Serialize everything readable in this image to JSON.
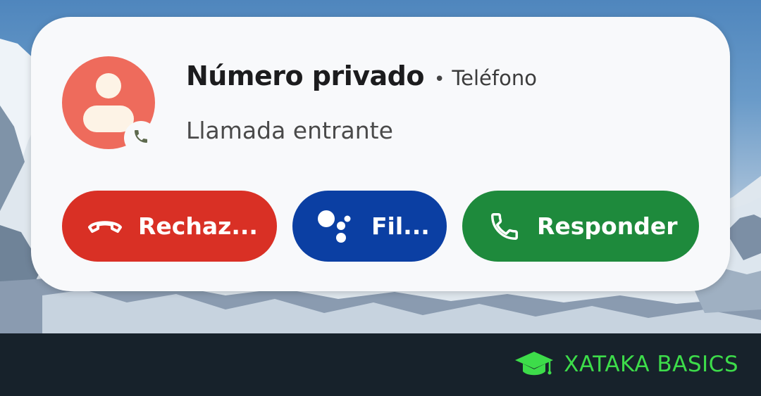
{
  "notification": {
    "caller_name": "Número privado",
    "separator": "•",
    "app_name": "Teléfono",
    "status": "Llamada entrante",
    "avatar_icon": "person-icon",
    "badge_icon": "phone-icon"
  },
  "actions": {
    "decline_label": "Rechaz...",
    "decline_icon": "hang-up-icon",
    "screen_label": "Fil...",
    "screen_icon": "google-assistant-icon",
    "answer_label": "Responder",
    "answer_icon": "phone-icon"
  },
  "colors": {
    "decline": "#d93025",
    "screen": "#0b3fa3",
    "answer": "#1e8a3c",
    "avatar": "#ee6b5c",
    "brand": "#3ddc4a",
    "footer": "#17222b"
  },
  "footer": {
    "brand_text": "XATAKA BASICS",
    "brand_icon": "graduation-cap-icon"
  }
}
